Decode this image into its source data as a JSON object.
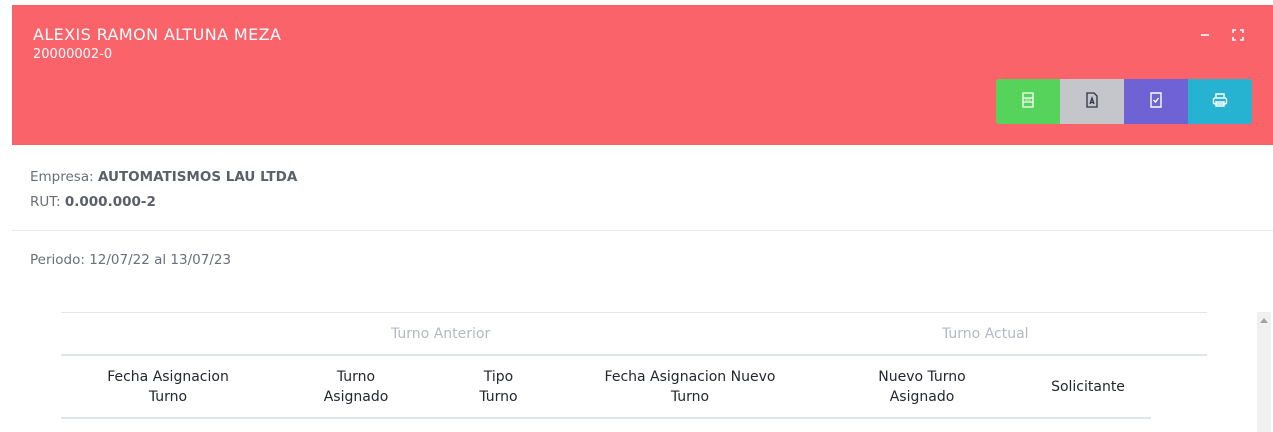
{
  "header": {
    "title": "ALEXIS RAMON ALTUNA MEZA",
    "subtitle": "20000002-0",
    "background_color": "#fb636b",
    "window_controls": [
      "minimize-icon",
      "fullscreen-icon"
    ],
    "export_buttons": [
      {
        "name": "excel-export",
        "icon": "excel-icon",
        "color": "#55d35a"
      },
      {
        "name": "pdf-export",
        "icon": "pdf-icon",
        "color": "#c4c6cc"
      },
      {
        "name": "document-export",
        "icon": "document-check-icon",
        "color": "#6f62d4"
      },
      {
        "name": "print",
        "icon": "print-icon",
        "color": "#26b3d2"
      }
    ]
  },
  "info": {
    "company_label": "Empresa:",
    "company_value": "AUTOMATISMOS LAU LTDA",
    "rut_label": "RUT:",
    "rut_value": "0.000.000-2"
  },
  "period": {
    "text": "Periodo: 12/07/22 al 13/07/23"
  },
  "table": {
    "groups": [
      "Turno Anterior",
      "Turno Actual"
    ],
    "columns": [
      {
        "line1": "Fecha Asignacion",
        "line2": "Turno"
      },
      {
        "line1": "Turno",
        "line2": "Asignado"
      },
      {
        "line1": "Tipo",
        "line2": "Turno"
      },
      {
        "line1": "Fecha Asignacion Nuevo",
        "line2": "Turno"
      },
      {
        "line1": "Nuevo Turno",
        "line2": "Asignado"
      },
      {
        "line1": "Solicitante",
        "line2": ""
      }
    ]
  }
}
